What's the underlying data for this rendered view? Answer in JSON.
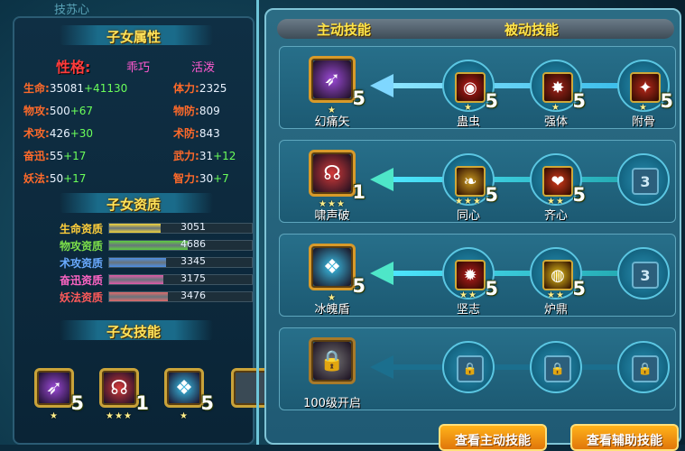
{
  "left": {
    "attributes_title": "子女属性",
    "trait_label": "性格:",
    "traits": [
      "乖巧",
      "活泼"
    ],
    "stats_left": [
      {
        "label": "生命:",
        "value": "35081",
        "bonus": "+41130"
      },
      {
        "label": "物攻:",
        "value": "500",
        "bonus": "+67"
      },
      {
        "label": "术攻:",
        "value": "426",
        "bonus": "+30"
      },
      {
        "label": "奋迅:",
        "value": "55",
        "bonus": "+17"
      },
      {
        "label": "妖法:",
        "value": "50",
        "bonus": "+17"
      }
    ],
    "stats_right": [
      {
        "label": "体力:",
        "value": "2325",
        "bonus": ""
      },
      {
        "label": "物防:",
        "value": "809",
        "bonus": ""
      },
      {
        "label": "术防:",
        "value": "843",
        "bonus": ""
      },
      {
        "label": "武力:",
        "value": "31",
        "bonus": "+12"
      },
      {
        "label": "智力:",
        "value": "30",
        "bonus": "+7"
      }
    ],
    "aptitude_title": "子女资质",
    "aptitudes": [
      {
        "label": "生命资质",
        "value": "3051",
        "fill": 0.36,
        "label_color": "#ffcf3a",
        "bar_color": "#f4d63a"
      },
      {
        "label": "物攻资质",
        "value": "4686",
        "fill": 0.55,
        "label_color": "#7de04a",
        "bar_color": "#5fcf3f"
      },
      {
        "label": "术攻资质",
        "value": "3345",
        "fill": 0.4,
        "label_color": "#6aaaff",
        "bar_color": "#4e8fe6"
      },
      {
        "label": "奋迅资质",
        "value": "3175",
        "fill": 0.38,
        "label_color": "#ff64c4",
        "bar_color": "#e25aa8"
      },
      {
        "label": "妖法资质",
        "value": "3476",
        "fill": 0.41,
        "label_color": "#ff5a5a",
        "bar_color": "#e06a6a"
      }
    ],
    "skills_title": "子女技能",
    "skills": [
      {
        "name": "phantom-arrow-icon",
        "level": "5",
        "stars": "★",
        "color": "#9b4ad6"
      },
      {
        "name": "scream-icon",
        "level": "1",
        "stars": "★★★",
        "color": "#d23a3a"
      },
      {
        "name": "ice-shield-icon",
        "level": "5",
        "stars": "★",
        "color": "#3ac0e8"
      }
    ]
  },
  "right": {
    "tab_active": "主动技能",
    "tab_passive": "被动技能",
    "rows": [
      {
        "active": {
          "name": "幻痛矢",
          "level": "5",
          "stars": "★"
        },
        "passives": [
          {
            "name": "蛊虫",
            "level": "5",
            "stars": "★"
          },
          {
            "name": "强体",
            "level": "5",
            "stars": "★"
          },
          {
            "name": "附骨",
            "level": "5",
            "stars": "★"
          }
        ]
      },
      {
        "active": {
          "name": "啸声破",
          "level": "1",
          "stars": "★★★"
        },
        "passives": [
          {
            "name": "同心",
            "level": "5",
            "stars": "★★★"
          },
          {
            "name": "齐心",
            "level": "5",
            "stars": "★★"
          },
          {
            "name": "",
            "level": "3",
            "stars": ""
          }
        ]
      },
      {
        "active": {
          "name": "冰魄盾",
          "level": "5",
          "stars": "★"
        },
        "passives": [
          {
            "name": "坚志",
            "level": "5",
            "stars": "★★"
          },
          {
            "name": "炉鼎",
            "level": "5",
            "stars": "★★"
          },
          {
            "name": "",
            "level": "3",
            "stars": ""
          }
        ]
      },
      {
        "active": {
          "name": "100级开启",
          "level": "",
          "stars": ""
        },
        "passives": [
          {
            "name": "",
            "level": "",
            "stars": ""
          },
          {
            "name": "",
            "level": "",
            "stars": ""
          },
          {
            "name": "",
            "level": "",
            "stars": ""
          }
        ]
      }
    ],
    "btn_active": "查看主动技能",
    "btn_assist": "查看辅助技能"
  },
  "colors": {
    "accent": "#ffe54a",
    "frame": "#2b6c84",
    "beam": "#4ee6ff"
  }
}
